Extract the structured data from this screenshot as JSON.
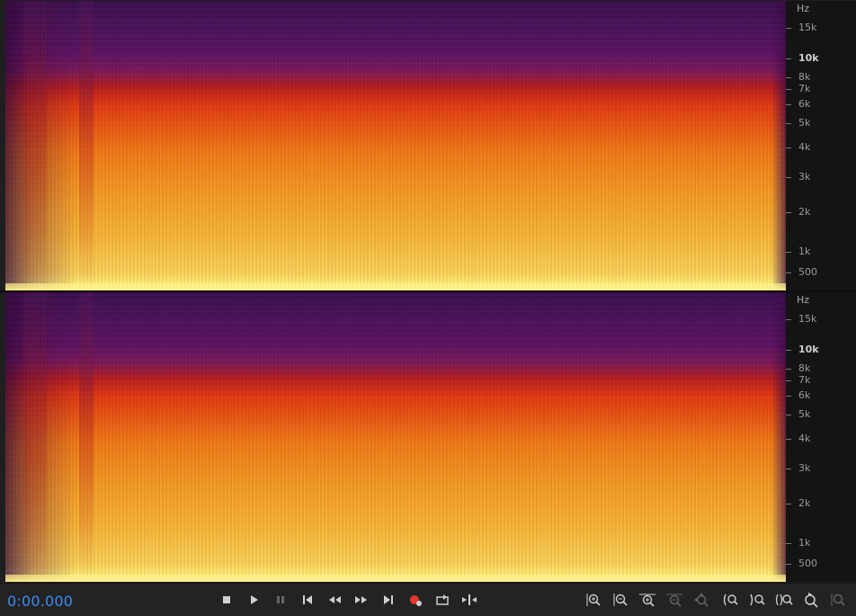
{
  "transport": {
    "time": "0:00.000"
  },
  "ruler": {
    "unit": "Hz",
    "ticks": [
      {
        "label": "15k"
      },
      {
        "label": "10k"
      },
      {
        "label": "8k"
      },
      {
        "label": "7k"
      },
      {
        "label": "6k"
      },
      {
        "label": "5k"
      },
      {
        "label": "4k"
      },
      {
        "label": "3k"
      },
      {
        "label": "2k"
      },
      {
        "label": "1k"
      },
      {
        "label": "500"
      }
    ]
  },
  "colors": {
    "accent_time": "#3a8df0",
    "record_dot": "#e3382b"
  },
  "icons": {
    "stop": "stop-icon",
    "play": "play-icon",
    "pause": "pause-icon",
    "to_start": "skip-to-start-icon",
    "rewind": "rewind-icon",
    "fast_forward": "fast-forward-icon",
    "to_end": "skip-to-end-icon",
    "record": "record-icon",
    "loop": "loop-playback-icon",
    "skip_selection": "skip-selection-icon",
    "zoom_in_amplitude": "zoom-in-amplitude-icon",
    "zoom_out_amplitude": "zoom-out-amplitude-icon",
    "zoom_in_time": "zoom-in-time-icon",
    "zoom_out_time": "zoom-out-time-icon",
    "zoom_selection": "zoom-selection-icon",
    "zoom_in_left": "zoom-in-at-left-edge-icon",
    "zoom_in_right": "zoom-in-at-right-edge-icon",
    "zoom_in_selection": "zoom-to-selection-icon",
    "zoom_reset": "zoom-reset-icon",
    "zoom_full": "zoom-full-icon"
  }
}
